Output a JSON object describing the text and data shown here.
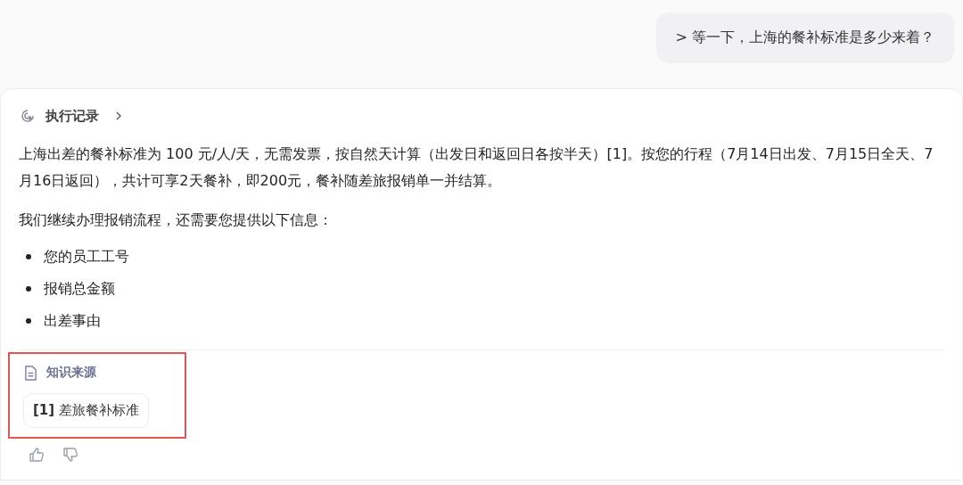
{
  "user_message": {
    "text": "> 等一下，上海的餐补标准是多少来着？"
  },
  "answer": {
    "execution_log": {
      "label": "执行记录",
      "expanded": false
    },
    "paragraphs": [
      "上海出差的餐补标准为 100 元/人/天，无需发票，按自然天计算（出发日和返回日各按半天）[1]。按您的行程（7月14日出发、7月15日全天、7月16日返回），共计可享2天餐补，即200元，餐补随差旅报销单一并结算。",
      "我们继续办理报销流程，还需要您提供以下信息："
    ],
    "bullets": [
      "您的员工工号",
      "报销总金额",
      "出差事由"
    ],
    "sources": {
      "title": "知识来源",
      "highlighted": true,
      "items": [
        {
          "index": "[1]",
          "title": "差旅餐补标准"
        }
      ]
    }
  }
}
